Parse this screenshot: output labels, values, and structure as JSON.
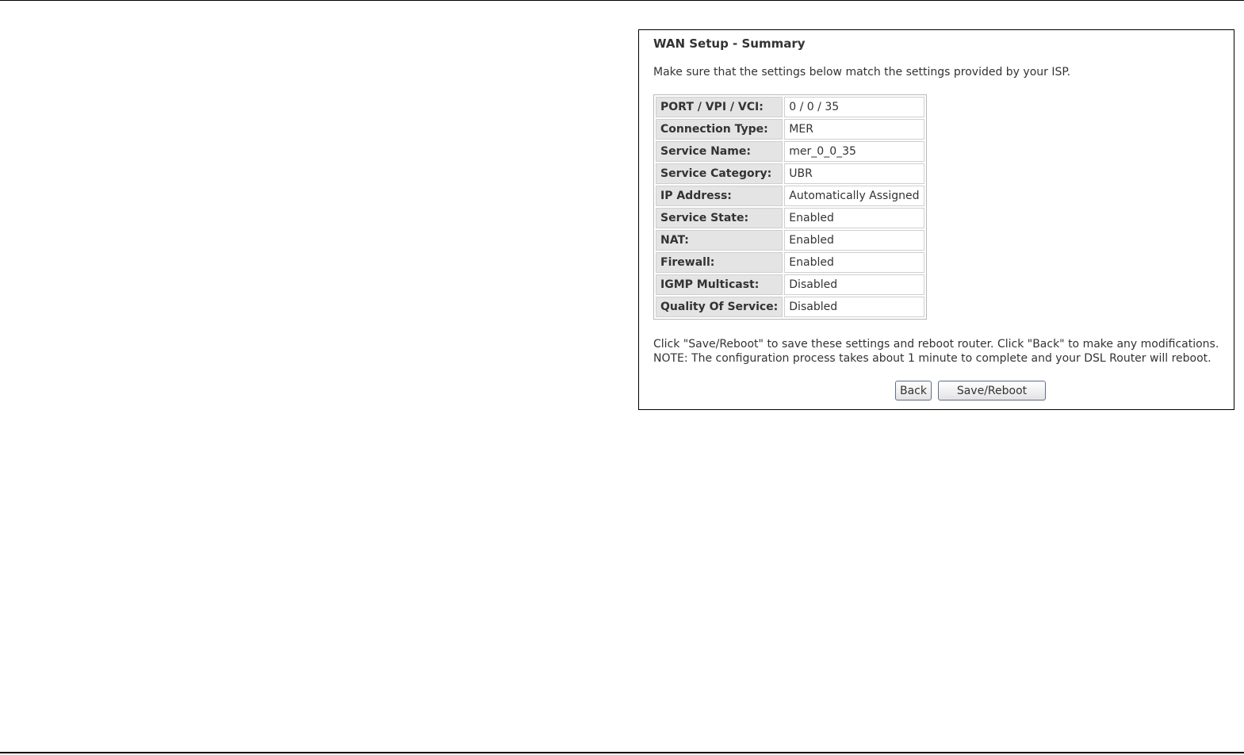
{
  "summary": {
    "title": "WAN Setup - Summary",
    "intro": "Make sure that the settings below match the settings provided by your ISP.",
    "rows": [
      {
        "label": "PORT / VPI / VCI:",
        "value": "0 / 0 / 35"
      },
      {
        "label": "Connection Type:",
        "value": "MER"
      },
      {
        "label": "Service Name:",
        "value": "mer_0_0_35"
      },
      {
        "label": "Service Category:",
        "value": "UBR"
      },
      {
        "label": "IP Address:",
        "value": "Automatically Assigned"
      },
      {
        "label": "Service State:",
        "value": "Enabled"
      },
      {
        "label": "NAT:",
        "value": "Enabled"
      },
      {
        "label": "Firewall:",
        "value": "Enabled"
      },
      {
        "label": "IGMP Multicast:",
        "value": "Disabled"
      },
      {
        "label": "Quality Of Service:",
        "value": "Disabled"
      }
    ],
    "instructions_line1": "Click \"Save/Reboot\" to save these settings and reboot router. Click \"Back\" to make any modifications.",
    "instructions_line2": "NOTE: The configuration process takes about 1 minute to complete and your DSL Router will reboot.",
    "buttons": {
      "back_label": "Back",
      "save_reboot_label": "Save/Reboot"
    }
  }
}
